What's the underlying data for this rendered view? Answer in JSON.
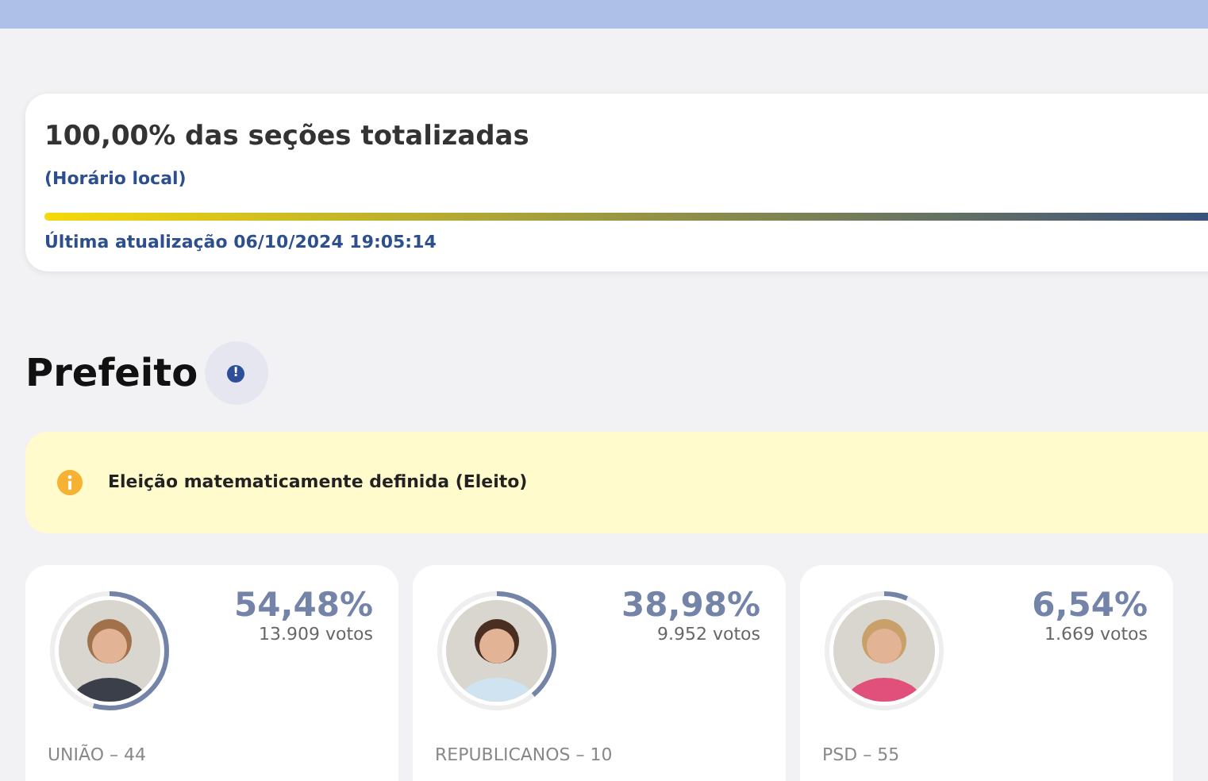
{
  "progress": {
    "title": "100,00% das seções totalizadas",
    "subtitle": "(Horário local)",
    "level": 1,
    "updated": "Última atualização 06/10/2024 19:05:14"
  },
  "section": {
    "title": "Prefeito",
    "info_icon": "!"
  },
  "alert": {
    "text": "Eleição matematicamente definida (Eleito)"
  },
  "candidates": [
    {
      "percent": "54,48%",
      "votes": "13.909 votos",
      "level": 0.5448,
      "party": "UNIÃO – 44"
    },
    {
      "percent": "38,98%",
      "votes": "9.952 votos",
      "level": 0.3898,
      "party": "REPUBLICANOS – 10"
    },
    {
      "percent": "6,54%",
      "votes": "1.669 votos",
      "level": 0.0654,
      "party": "PSD – 55"
    }
  ]
}
